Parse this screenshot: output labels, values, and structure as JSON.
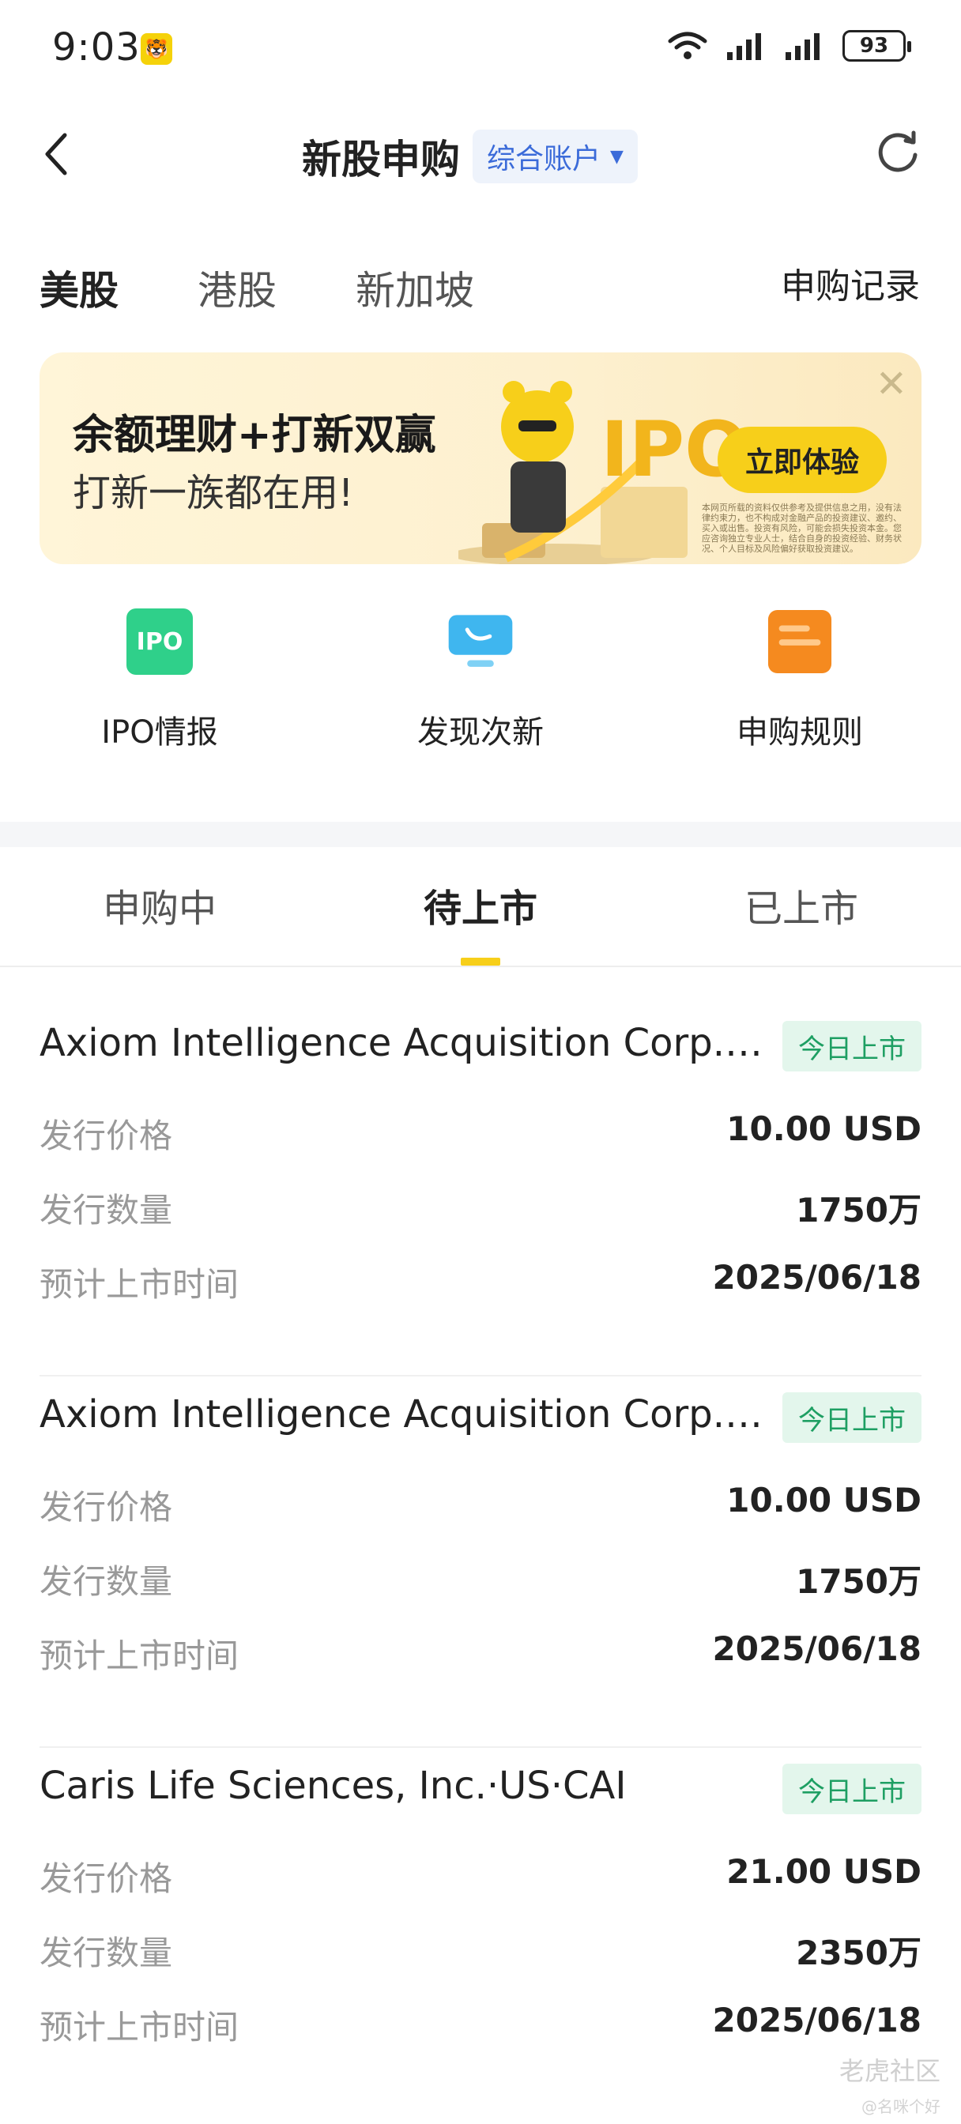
{
  "status_bar": {
    "time": "9:03",
    "battery": "93"
  },
  "header": {
    "title": "新股申购",
    "account": "综合账户"
  },
  "market_tabs": [
    "美股",
    "港股",
    "新加坡"
  ],
  "records_link": "申购记录",
  "banner": {
    "line1": "余额理财+打新双赢",
    "line2": "打新一族都在用!",
    "cta": "立即体验",
    "art_text": "IPO",
    "disclaimer": "本网页所载的资料仅供参考及提供信息之用，没有法律约束力，也不构成对金融产品的投资建议、邀约、买入或出售。投资有风险，可能会损失投资本金。您应咨询独立专业人士，结合自身的投资经验、财务状况、个人目标及风险偏好获取投资建议。"
  },
  "quick_actions": [
    {
      "label": "IPO情报",
      "icon": "ipo-icon",
      "icon_text": "IPO",
      "color": "#2fd08a"
    },
    {
      "label": "发现次新",
      "icon": "monitor-icon",
      "color": "#3fb6ef"
    },
    {
      "label": "申购规则",
      "icon": "document-icon",
      "color": "#f58a1f"
    }
  ],
  "status_tabs": [
    "申购中",
    "待上市",
    "已上市"
  ],
  "active_status_tab": "待上市",
  "field_labels": {
    "price": "发行价格",
    "quantity": "发行数量",
    "listing_time": "预计上市时间"
  },
  "ipos": [
    {
      "name": "Axiom Intelligence Acquisition Corp. I·...",
      "badge": "今日上市",
      "price": "10.00 USD",
      "quantity": "1750万",
      "listing_date": "2025/06/18"
    },
    {
      "name": "Axiom Intelligence Acquisition Corp. I·...",
      "badge": "今日上市",
      "price": "10.00 USD",
      "quantity": "1750万",
      "listing_date": "2025/06/18"
    },
    {
      "name": "Caris Life Sciences, Inc.·US·CAI",
      "badge": "今日上市",
      "price": "21.00 USD",
      "quantity": "2350万",
      "listing_date": "2025/06/18"
    }
  ],
  "watermark": {
    "text": "老虎社区",
    "sub": "@名咪个好"
  },
  "colors": {
    "accent_yellow": "#f7cf1a",
    "badge_green": "#1e9f63",
    "badge_bg": "#e3f6ec",
    "account_blue": "#3b6bd9"
  }
}
